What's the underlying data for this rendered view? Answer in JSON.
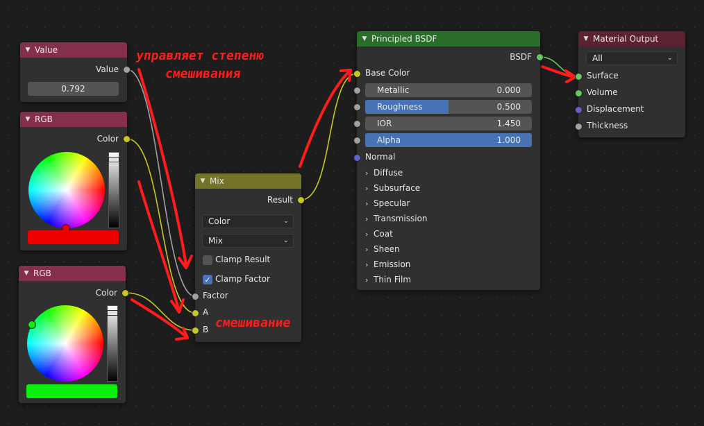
{
  "colors": {
    "value_header": "#85304a",
    "rgb_header": "#85304a",
    "mix_header": "#737327",
    "bsdf_header": "#2b6e2b",
    "output_header": "#5b2232",
    "red_swatch": "#ee0000",
    "green_swatch": "#0eee0e",
    "annotation": "#ff1c1c"
  },
  "value_node": {
    "title": "Value",
    "output_label": "Value",
    "value": "0.792"
  },
  "rgb_node_1": {
    "title": "RGB",
    "output_label": "Color",
    "swatch_color": "red"
  },
  "rgb_node_2": {
    "title": "RGB",
    "output_label": "Color",
    "swatch_color": "green"
  },
  "mix_node": {
    "title": "Mix",
    "output_label": "Result",
    "data_type": "Color",
    "blend_mode": "Mix",
    "clamp_result_label": "Clamp Result",
    "clamp_result": false,
    "clamp_factor_label": "Clamp Factor",
    "clamp_factor": true,
    "input_factor": "Factor",
    "input_a": "A",
    "input_b": "B"
  },
  "bsdf_node": {
    "title": "Principled BSDF",
    "output_label": "BSDF",
    "base_color": "Base Color",
    "metallic": {
      "label": "Metallic",
      "value": "0.000",
      "fraction": 0
    },
    "roughness": {
      "label": "Roughness",
      "value": "0.500",
      "fraction": 0.5
    },
    "ior": {
      "label": "IOR",
      "value": "1.450",
      "fraction": 0
    },
    "alpha": {
      "label": "Alpha",
      "value": "1.000",
      "fraction": 1
    },
    "normal": "Normal",
    "panels": [
      "Diffuse",
      "Subsurface",
      "Specular",
      "Transmission",
      "Coat",
      "Sheen",
      "Emission",
      "Thin Film"
    ]
  },
  "output_node": {
    "title": "Material Output",
    "target": "All",
    "inputs": [
      "Surface",
      "Volume",
      "Displacement",
      "Thickness"
    ]
  },
  "annotations": {
    "top_line1": "управляет степеню",
    "top_line2": "смешивания",
    "bottom": "смешивание"
  }
}
